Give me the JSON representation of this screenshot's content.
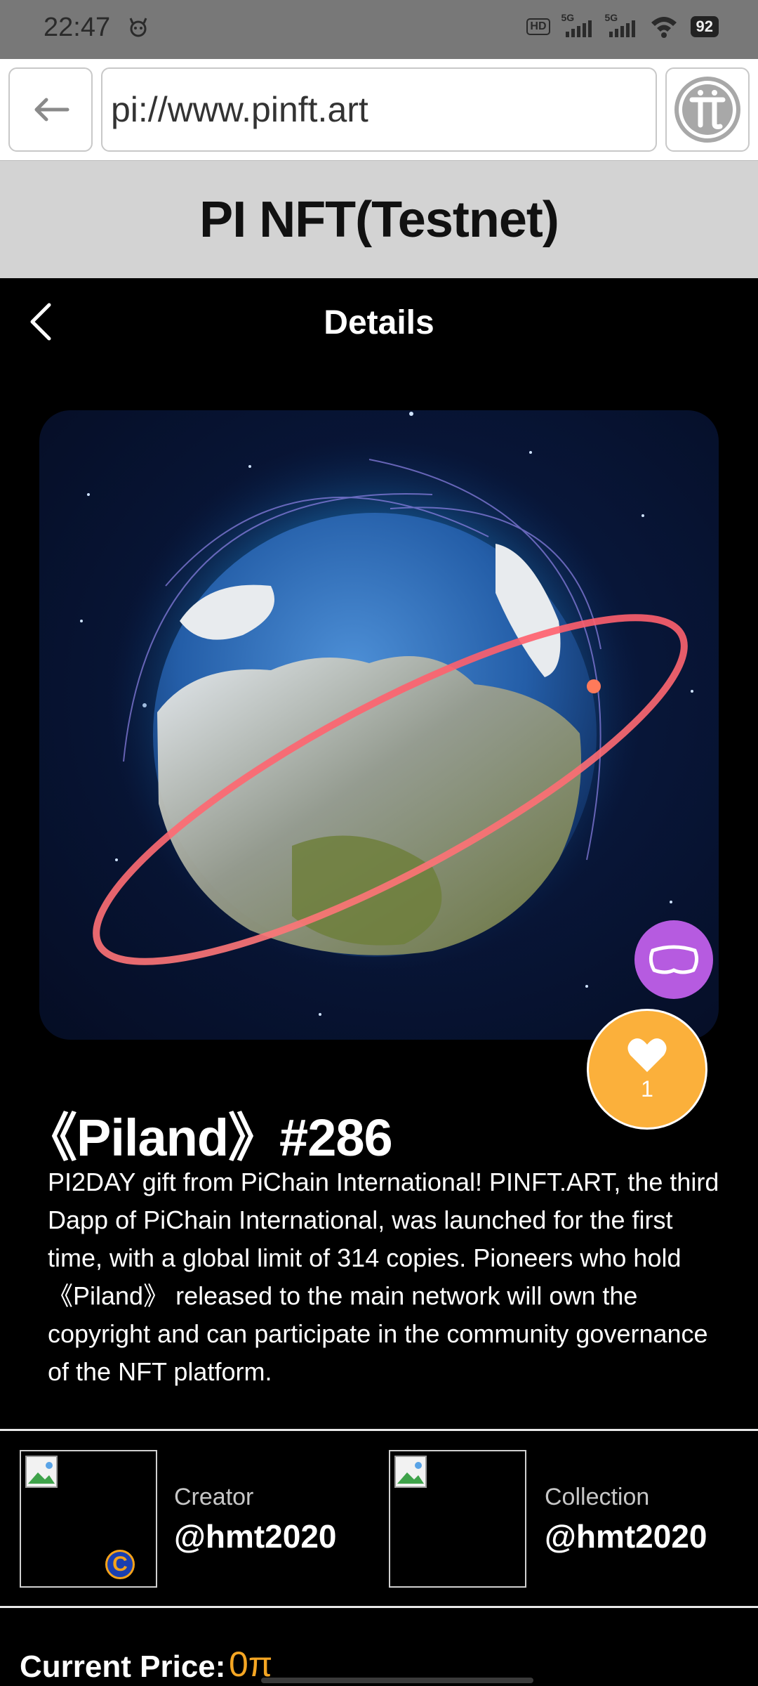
{
  "status_bar": {
    "time": "22:47",
    "network_1": "5G",
    "network_2": "5G",
    "hd_label": "HD",
    "battery": "92",
    "icons": [
      "notification-icon",
      "hd-icon",
      "signal-icon",
      "signal-icon",
      "wifi-icon",
      "battery-icon"
    ]
  },
  "browser": {
    "url": "pi://www.pinft.art",
    "icons": [
      "back-arrow-icon",
      "pi-logo-icon"
    ]
  },
  "site": {
    "title": "PI NFT(Testnet)"
  },
  "details": {
    "title": "Details",
    "icons": [
      "chevron-left-icon"
    ]
  },
  "nft": {
    "image_subject": "planet-globe-artwork",
    "title": "《Piland》#286",
    "likes": "1",
    "description": "PI2DAY gift from PiChain International! PINFT.ART, the third Dapp of PiChain International, was launched for the first time, with a global limit of 314 copies. Pioneers who hold 《Piland》 released to the main network will own the copyright and can participate in the community governance of the NFT platform.",
    "icons": [
      "vr-headset-icon",
      "heart-icon"
    ]
  },
  "creator": {
    "label": "Creator",
    "value": "@hmt2020",
    "badge": "C"
  },
  "collection": {
    "label": "Collection",
    "value": "@hmt2020"
  },
  "price": {
    "label": "Current Price:",
    "value": "0π"
  },
  "colors": {
    "status_bar_bg": "#787878",
    "site_header_bg": "#d3d3d3",
    "page_bg": "#000000",
    "like_button": "#fbb03b",
    "vr_button": "#b65be0",
    "price_accent": "#f5a623"
  }
}
